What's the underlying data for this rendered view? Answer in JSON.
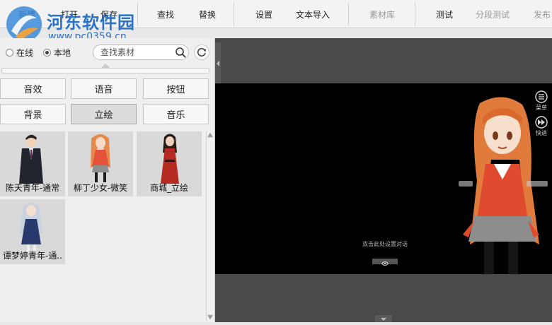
{
  "toolbar": {
    "new": "新建",
    "open": "打开",
    "save": "保存",
    "find": "查找",
    "replace": "替换",
    "settings": "设置",
    "text_import": "文本导入",
    "material_lib": "素材库",
    "test": "测试",
    "segment_test": "分段测试",
    "publish": "发布"
  },
  "watermark": {
    "title": "河东软件园",
    "url": "www.pc0359.cn"
  },
  "source": {
    "online": "在线",
    "local": "本地",
    "selected": "local"
  },
  "search": {
    "placeholder": "查找素材",
    "value": ""
  },
  "categories": [
    {
      "label": "音效"
    },
    {
      "label": "语音"
    },
    {
      "label": "按钮"
    },
    {
      "label": "背景"
    },
    {
      "label": "立绘",
      "active": true
    },
    {
      "label": "音乐"
    }
  ],
  "assets": [
    {
      "label": "陈天青年-通常"
    },
    {
      "label": "柳丁少女-微笑"
    },
    {
      "label": "商城_立绘"
    },
    {
      "label": "谭梦婷青年-通.."
    }
  ],
  "preview": {
    "dialog_hint": "双击此处设置对话",
    "menu_label": "菜单",
    "skip_label": "快进"
  }
}
